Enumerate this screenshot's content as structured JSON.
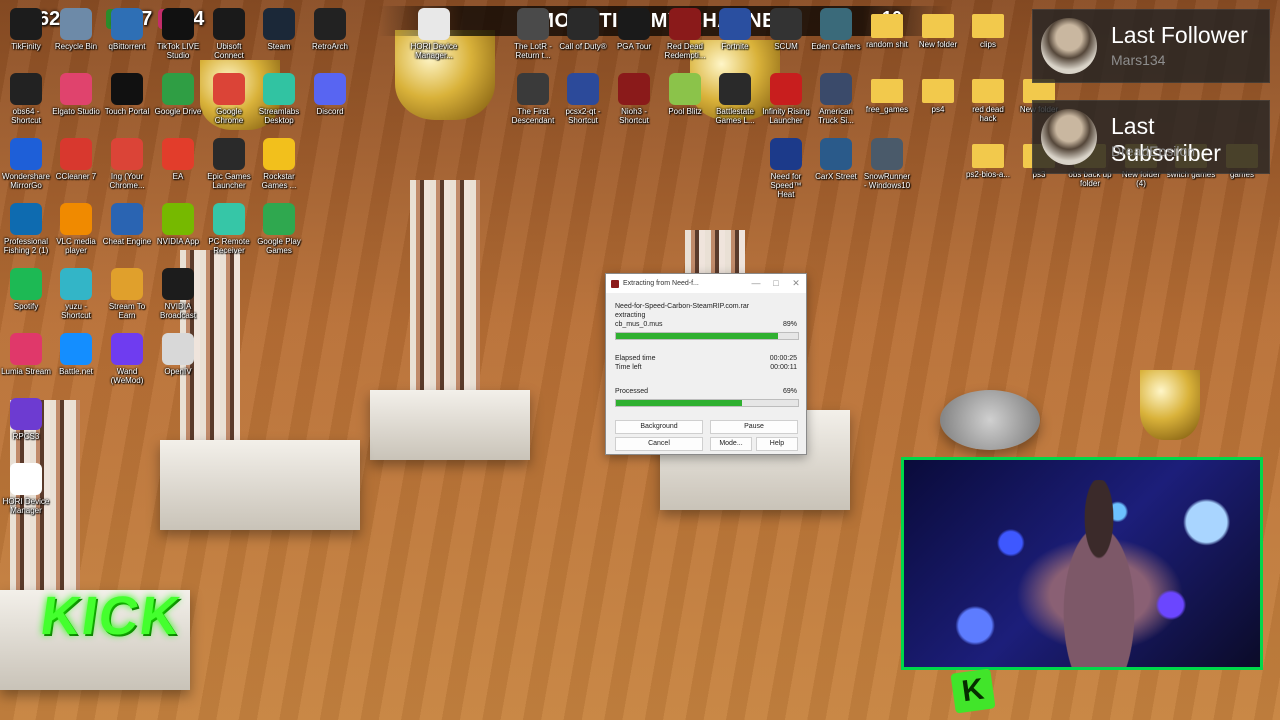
{
  "counters": [
    {
      "icon": "kick-icon",
      "value": "62",
      "color": "#27c93f"
    },
    {
      "icon": "follower-icon",
      "value": "67",
      "color": "#2a8d2a"
    },
    {
      "icon": "signal-icon",
      "value": "44",
      "color": "#c42d6a"
    }
  ],
  "banner": {
    "left_count": "0",
    "text": "MONETIZE MY CHANNEL",
    "right_count": "10"
  },
  "stats": {
    "follower": {
      "title": "Last Follower",
      "name": "Mars134"
    },
    "subscriber": {
      "title": "Last Subscriber",
      "name": "DreadEpsilon"
    }
  },
  "desktop_icons": [
    {
      "label": "TikFinity",
      "icon": "tikfinity-icon",
      "color": "#1c1c1c"
    },
    {
      "label": "Recycle Bin",
      "icon": "recycle-bin-icon",
      "color": "#6d8aa8"
    },
    {
      "label": "qBittorrent",
      "icon": "qbittorrent-icon",
      "color": "#2e6fb5"
    },
    {
      "label": "TikTok LIVE Studio",
      "icon": "tiktok-icon",
      "color": "#111111"
    },
    {
      "label": "Ubisoft Connect",
      "icon": "ubisoft-icon",
      "color": "#1a1a1a"
    },
    {
      "label": "Steam",
      "icon": "steam-icon",
      "color": "#1b2838"
    },
    {
      "label": "RetroArch",
      "icon": "retroarch-icon",
      "color": "#222222"
    },
    {
      "label": "obs64 - Shortcut",
      "icon": "obs-icon",
      "color": "#222222"
    },
    {
      "label": "Elgato Studio",
      "icon": "elgato-icon",
      "color": "#e0436d"
    },
    {
      "label": "Touch Portal",
      "icon": "touch-portal-icon",
      "color": "#111111"
    },
    {
      "label": "Google Drive",
      "icon": "google-drive-icon",
      "color": "#2f9e44"
    },
    {
      "label": "Google Chrome",
      "icon": "chrome-icon",
      "color": "#db4437"
    },
    {
      "label": "Streamlabs Desktop",
      "icon": "streamlabs-icon",
      "color": "#31c3a2"
    },
    {
      "label": "Discord",
      "icon": "discord-icon",
      "color": "#5865f2"
    },
    {
      "label": "Wondershare MirrorGo",
      "icon": "mirrorgo-icon",
      "color": "#1e5fd8"
    },
    {
      "label": "CCleaner 7",
      "icon": "ccleaner-icon",
      "color": "#d8382e"
    },
    {
      "label": "Ing (Your Chrome...",
      "icon": "chrome-icon",
      "color": "#db4437"
    },
    {
      "label": "EA",
      "icon": "ea-icon",
      "color": "#e23d2b"
    },
    {
      "label": "Epic Games Launcher",
      "icon": "epic-games-icon",
      "color": "#2a2a2a"
    },
    {
      "label": "Rockstar Games ...",
      "icon": "rockstar-icon",
      "color": "#f2c01c"
    },
    {
      "label": "Professional Fishing 2 (1)",
      "icon": "fishing-icon",
      "color": "#0e6bb0"
    },
    {
      "label": "VLC media player",
      "icon": "vlc-icon",
      "color": "#f08a00"
    },
    {
      "label": "Cheat Engine",
      "icon": "cheat-engine-icon",
      "color": "#2a64b2"
    },
    {
      "label": "NVIDIA App",
      "icon": "nvidia-icon",
      "color": "#76b900"
    },
    {
      "label": "PC Remote Receiver",
      "icon": "pc-remote-icon",
      "color": "#36c6a7"
    },
    {
      "label": "Google Play Games",
      "icon": "google-play-icon",
      "color": "#2fa84f"
    },
    {
      "label": "Spotify",
      "icon": "spotify-icon",
      "color": "#1db954"
    },
    {
      "label": "yuzu - Shortcut",
      "icon": "yuzu-icon",
      "color": "#33b5c7"
    },
    {
      "label": "Stream To Earn",
      "icon": "stream-to-earn-icon",
      "color": "#e0a02c"
    },
    {
      "label": "NVIDIA Broadcast",
      "icon": "nvidia-broadcast-icon",
      "color": "#1c1c1c"
    },
    {
      "label": "Lumia Stream",
      "icon": "lumia-icon",
      "color": "#e0386a"
    },
    {
      "label": "Battle.net",
      "icon": "battle-net-icon",
      "color": "#148eff"
    },
    {
      "label": "Wand (WeMod)",
      "icon": "wand-icon",
      "color": "#6f3cf0"
    },
    {
      "label": "OpenIV",
      "icon": "openiv-icon",
      "color": "#d8d8d8"
    },
    {
      "label": "RPCS3",
      "icon": "rpcs3-icon",
      "color": "#6d3bd1"
    },
    {
      "label": "HORI Device Manager",
      "icon": "hori-icon",
      "color": "#ffffff"
    },
    {
      "label": "HORI Device Manager...",
      "icon": "hori-icon",
      "color": "#e8e8e8"
    },
    {
      "label": "The LotR - Return t...",
      "icon": "lotr-icon",
      "color": "#4a4a4a"
    },
    {
      "label": "Call of Duty®",
      "icon": "cod-icon",
      "color": "#2a2a2a"
    },
    {
      "label": "PGA Tour",
      "icon": "pga-icon",
      "color": "#1a1a1a"
    },
    {
      "label": "Red Dead Redempti...",
      "icon": "rdr-icon",
      "color": "#8a1a1a"
    },
    {
      "label": "Fortnite",
      "icon": "fortnite-icon",
      "color": "#2a4fa0"
    },
    {
      "label": "SCUM",
      "icon": "scum-icon",
      "color": "#333333"
    },
    {
      "label": "Eden Crafters",
      "icon": "eden-crafters-icon",
      "color": "#3a6a7a"
    },
    {
      "label": "random shit",
      "icon": "folder-icon",
      "color": "#f2c94c"
    },
    {
      "label": "New folder",
      "icon": "folder-icon",
      "color": "#f2c94c"
    },
    {
      "label": "clips",
      "icon": "folder-icon",
      "color": "#f2c94c"
    },
    {
      "label": "The First Descendant",
      "icon": "first-descendant-icon",
      "color": "#3a3a3a"
    },
    {
      "label": "pcsx2-qt - Shortcut",
      "icon": "pcsx2-icon",
      "color": "#2c4a9a"
    },
    {
      "label": "Nioh3 - Shortcut",
      "icon": "nioh-icon",
      "color": "#8a1a1a"
    },
    {
      "label": "Pool Blitz",
      "icon": "pool-blitz-icon",
      "color": "#8bc34a"
    },
    {
      "label": "Battlestate Games L...",
      "icon": "battlestate-icon",
      "color": "#2a2a2a"
    },
    {
      "label": "Infinity Rising Launcher",
      "icon": "infinity-rising-icon",
      "color": "#c81e1e"
    },
    {
      "label": "American Truck Si...",
      "icon": "ats-icon",
      "color": "#3a4a6a"
    },
    {
      "label": "free_games",
      "icon": "folder-icon",
      "color": "#f2c94c"
    },
    {
      "label": "ps4",
      "icon": "folder-icon",
      "color": "#f2c94c"
    },
    {
      "label": "red dead hack",
      "icon": "folder-icon",
      "color": "#f2c94c"
    },
    {
      "label": "New folder",
      "icon": "folder-icon",
      "color": "#f2c94c"
    },
    {
      "label": "Need for Speed™ Heat",
      "icon": "nfs-icon",
      "color": "#1c3a8a"
    },
    {
      "label": "CarX Street",
      "icon": "carx-icon",
      "color": "#2a5a8a"
    },
    {
      "label": "SnowRunner - Windows10",
      "icon": "snowrunner-icon",
      "color": "#4a5a6a"
    },
    {
      "label": "ps2-bios-a...",
      "icon": "folder-icon",
      "color": "#f2c94c"
    },
    {
      "label": "ps3",
      "icon": "folder-icon",
      "color": "#f2c94c"
    },
    {
      "label": "obs back up folder",
      "icon": "folder-icon",
      "color": "#f2c94c"
    },
    {
      "label": "New folder (4)",
      "icon": "folder-icon",
      "color": "#f2c94c"
    },
    {
      "label": "switch games",
      "icon": "folder-icon",
      "color": "#f2c94c"
    },
    {
      "label": "games",
      "icon": "folder-icon",
      "color": "#f2c94c"
    }
  ],
  "dialog": {
    "title": "Extracting from Need-f...",
    "archive": "Need-for-Speed-Carbon-SteamRIP.com.rar",
    "action": "extracting",
    "file": "cb_mus_0.mus",
    "file_percent": "89%",
    "file_progress": 0.89,
    "elapsed_label": "Elapsed time",
    "elapsed": "00:00:25",
    "left_label": "Time left",
    "left": "00:00:11",
    "processed_label": "Processed",
    "processed_percent": "69%",
    "processed_progress": 0.69,
    "buttons": {
      "background": "Background",
      "pause": "Pause",
      "cancel": "Cancel",
      "mode": "Mode...",
      "help": "Help"
    }
  },
  "kick_logo": "KICK",
  "kick_badge": "K"
}
